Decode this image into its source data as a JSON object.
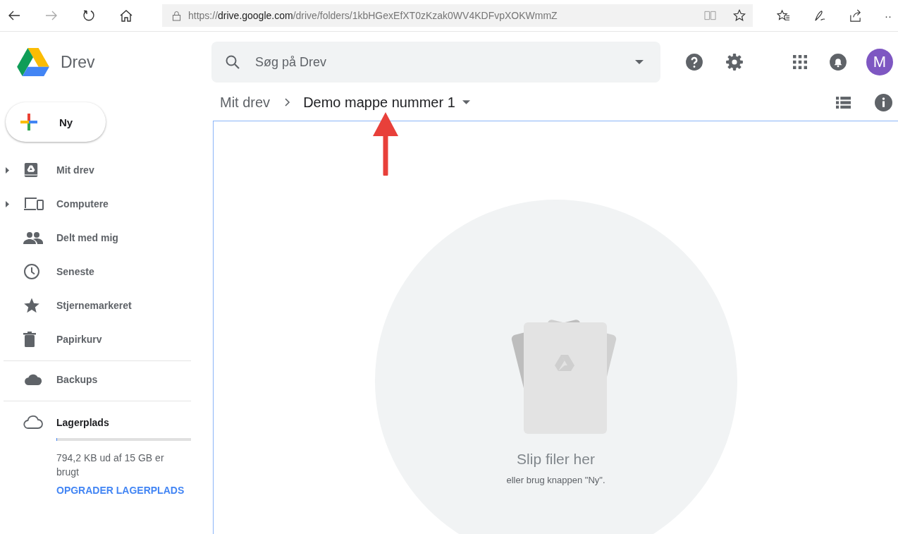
{
  "browser": {
    "url": {
      "scheme": "https://",
      "host": "drive.google.com",
      "path": "/drive/folders/1kbHGexEfXT0zKzak0WV4KDFvpXOKWmmZ"
    },
    "overflow": "··"
  },
  "app": {
    "title": "Drev",
    "search": {
      "placeholder": "Søg på Drev"
    },
    "avatar": "M"
  },
  "new_button": "Ny",
  "sidebar": {
    "sections": [
      [
        {
          "label": "Mit drev",
          "kind": "tree"
        },
        {
          "label": "Computere",
          "kind": "tree"
        },
        {
          "label": "Delt med mig",
          "kind": "link"
        },
        {
          "label": "Seneste",
          "kind": "link"
        },
        {
          "label": "Stjernemarkeret",
          "kind": "link"
        },
        {
          "label": "Papirkurv",
          "kind": "link"
        }
      ],
      [
        {
          "label": "Backups",
          "kind": "link"
        }
      ]
    ]
  },
  "storage": {
    "label": "Lagerplads",
    "level": 0.002,
    "usage": "794,2 KB ud af 15 GB er brugt",
    "upgrade": "OPGRADER LAGERPLADS"
  },
  "breadcrumb": [
    {
      "label": "Mit drev",
      "selected": false
    },
    {
      "label": "Demo mappe nummer 1",
      "selected": true
    }
  ],
  "empty_state": {
    "title": "Slip filer her",
    "hint": "eller brug knappen \"Ny\"."
  }
}
